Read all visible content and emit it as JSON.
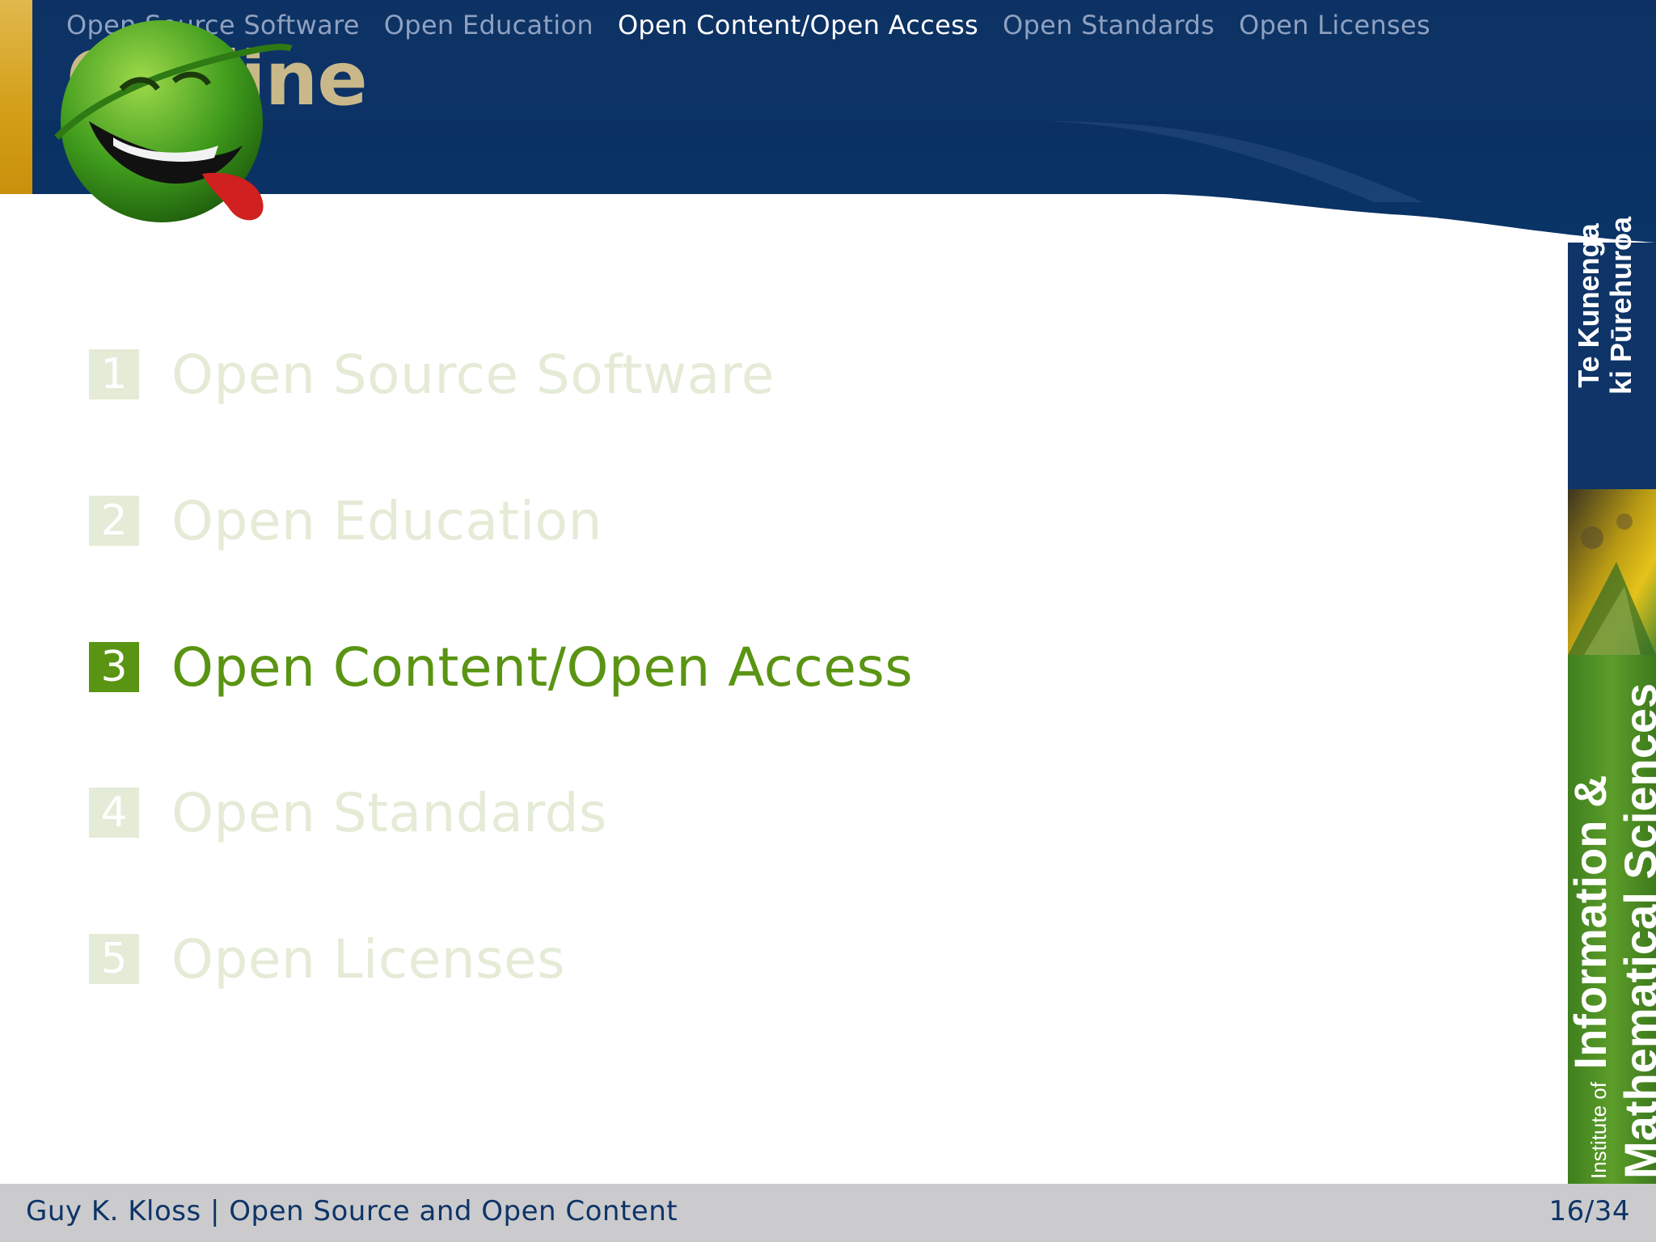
{
  "nav": {
    "items": [
      {
        "label": "Open Source Software",
        "active": false
      },
      {
        "label": "Open Education",
        "active": false
      },
      {
        "label": "Open Content/Open Access",
        "active": true
      },
      {
        "label": "Open Standards",
        "active": false
      },
      {
        "label": "Open Licenses",
        "active": false
      }
    ]
  },
  "title": "Outline",
  "outline": {
    "items": [
      {
        "number": "1",
        "label": "Open Source Software",
        "active": false
      },
      {
        "number": "2",
        "label": "Open Education",
        "active": false
      },
      {
        "number": "3",
        "label": "Open Content/Open Access",
        "active": true
      },
      {
        "number": "4",
        "label": "Open Standards",
        "active": false
      },
      {
        "number": "5",
        "label": "Open Licenses",
        "active": false
      }
    ]
  },
  "banner": {
    "top_line1": "Te Kunenga",
    "top_line2": "ki Pūrehuroa",
    "institute_prefix": "Institute of",
    "institute_line1": "Information &",
    "institute_line2": "Mathematical Sciences"
  },
  "footer": {
    "left": "Guy K. Kloss | Open Source and Open Content",
    "page": "16/34"
  },
  "colors": {
    "header_navy": "#0e3468",
    "title_gold": "#c9b98a",
    "accent_green": "#5a9413",
    "dim_green": "#e4ebd6",
    "footer_gray": "#cbcbcd",
    "left_bar_gold": "#d7a21a"
  }
}
